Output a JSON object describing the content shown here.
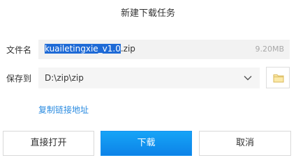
{
  "dialog": {
    "title": "新建下载任务"
  },
  "filename_row": {
    "label": "文件名",
    "value_selected": "kuailetingxie_v1.0",
    "value_rest": ".zip",
    "size": "9.20MB"
  },
  "saveto_row": {
    "label": "保存到",
    "path": "D:\\zip\\zip"
  },
  "links": {
    "copy_link": "复制链接地址"
  },
  "buttons": {
    "open_directly": "直接打开",
    "download": "下载",
    "cancel": "取消"
  },
  "colors": {
    "accent": "#0d8de9",
    "link": "#2a8be0",
    "selection": "#1e6ad6"
  },
  "icons": {
    "dropdown": "chevron-down-icon",
    "browse": "folder-icon"
  }
}
